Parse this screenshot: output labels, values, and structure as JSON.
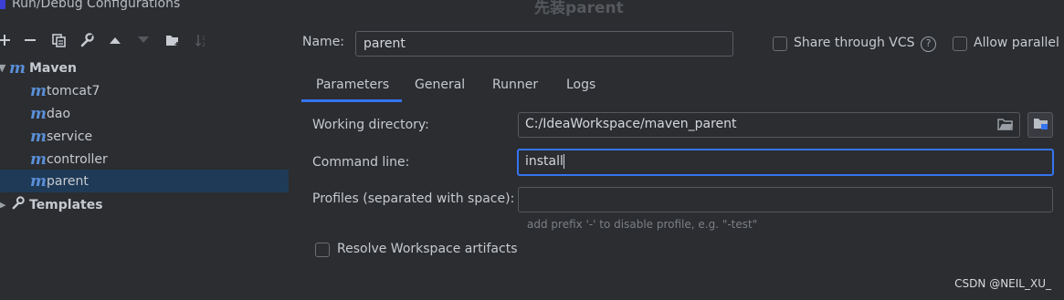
{
  "window": {
    "title": "Run/Debug Configurations",
    "dim_title": "先装parent"
  },
  "toolbar": {
    "icons": [
      "add-icon",
      "remove-icon",
      "copy-icon",
      "wrench-icon",
      "move-up-icon",
      "move-down-icon",
      "folder-icon",
      "sort-icon"
    ]
  },
  "tree": {
    "root_label": "Maven",
    "items": [
      {
        "label": "tomcat7"
      },
      {
        "label": "dao"
      },
      {
        "label": "service"
      },
      {
        "label": "controller"
      },
      {
        "label": "parent"
      }
    ],
    "templates_label": "Templates",
    "m_glyph": "m"
  },
  "name": {
    "label": "Name:",
    "value": "parent"
  },
  "options": {
    "share_vcs": "Share through VCS",
    "allow_parallel": "Allow parallel r"
  },
  "tabs": [
    {
      "label": "Parameters"
    },
    {
      "label": "General"
    },
    {
      "label": "Runner"
    },
    {
      "label": "Logs"
    }
  ],
  "form": {
    "working_dir_label": "Working directory:",
    "working_dir_value": "C:/IdeaWorkspace/maven_parent",
    "command_line_label": "Command line:",
    "command_line_value": "install",
    "profiles_label": "Profiles (separated with space):",
    "profiles_value": "",
    "profiles_hint": "add prefix '-' to disable profile, e.g. \"-test\"",
    "resolve_label": "Resolve Workspace artifacts"
  },
  "watermark": "CSDN @NEIL_XU_",
  "colors": {
    "accent": "#3574f0",
    "selected_row": "#1f3a57",
    "maven_icon": "#5a8fd8"
  }
}
